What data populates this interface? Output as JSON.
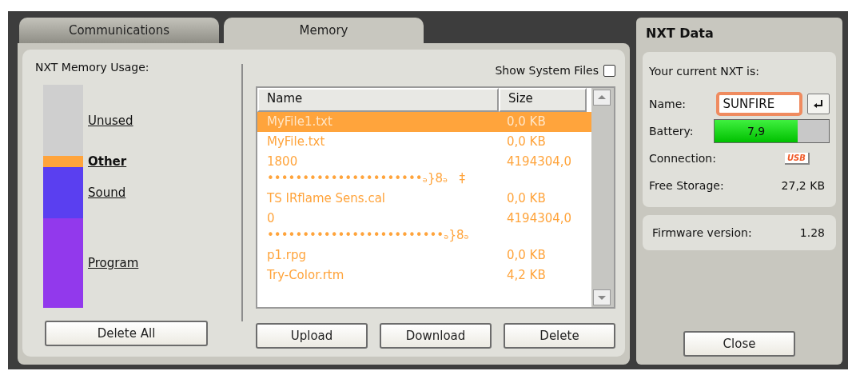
{
  "tabs": [
    {
      "label": "Communications",
      "selected": false
    },
    {
      "label": "Memory",
      "selected": true
    }
  ],
  "memory": {
    "title": "NXT Memory Usage:",
    "segments": [
      {
        "label": "Unused",
        "color": "#cfcfcf",
        "selected": false
      },
      {
        "label": "Other",
        "color": "#ffa43c",
        "selected": true
      },
      {
        "label": "Sound",
        "color": "#5a3ff0",
        "selected": false
      },
      {
        "label": "Program",
        "color": "#9239ec",
        "selected": false
      }
    ],
    "delete_all": "Delete All"
  },
  "files": {
    "show_system_files": {
      "label": "Show System Files",
      "checked": false
    },
    "columns": [
      "Name",
      "Size"
    ],
    "rows": [
      {
        "name": "MyFile1.txt",
        "size": "0,0 KB",
        "selected": true
      },
      {
        "name": "MyFile.txt",
        "size": "0,0 KB",
        "selected": false
      },
      {
        "name": "1800\n••••••••••••••••••••••ₔ}8ₔ   ‡",
        "size": "4194304,0",
        "selected": false
      },
      {
        "name": "TS IRflame Sens.cal",
        "size": "0,0 KB",
        "selected": false
      },
      {
        "name": "0\n•••••••••••••••••••••••••ₔ}8ₔ",
        "size": "4194304,0",
        "selected": false
      },
      {
        "name": "p1.rpg",
        "size": "0,0 KB",
        "selected": false
      },
      {
        "name": "Try-Color.rtm",
        "size": "4,2 KB",
        "selected": false
      }
    ],
    "buttons": [
      "Upload",
      "Download",
      "Delete"
    ]
  },
  "nxt": {
    "title": "NXT Data",
    "subtitle": "Your current NXT is:",
    "name_label": "Name:",
    "name_value": "SUNFIRE",
    "battery_label": "Battery:",
    "battery": {
      "level": 0.73,
      "reading": "7,9"
    },
    "connection_label": "Connection:",
    "connection": "USB",
    "storage_label": "Free Storage:",
    "storage": "27,2 KB",
    "firmware_label": "Firmware version:",
    "firmware": "1.28",
    "close": "Close"
  }
}
